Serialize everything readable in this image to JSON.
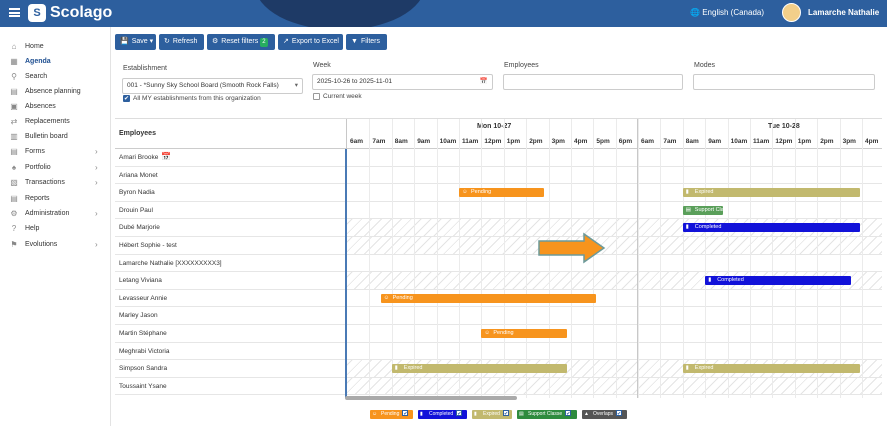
{
  "header": {
    "logo_glyph": "S",
    "app_name": "Scolago",
    "language": "English (Canada)",
    "user": "Lamarche Nathalie"
  },
  "sidebar": {
    "items": [
      {
        "label": "Home",
        "icon": "home-icon"
      },
      {
        "label": "Agenda",
        "icon": "calendar-icon",
        "active": true
      },
      {
        "label": "Search",
        "icon": "search-icon"
      },
      {
        "label": "Absence planning",
        "icon": "absence-planning-icon"
      },
      {
        "label": "Absences",
        "icon": "absences-icon"
      },
      {
        "label": "Replacements",
        "icon": "replacements-icon"
      },
      {
        "label": "Bulletin board",
        "icon": "bulletin-icon"
      },
      {
        "label": "Forms",
        "icon": "forms-icon",
        "chevron": true
      },
      {
        "label": "Portfolio",
        "icon": "trophy-icon",
        "chevron": true
      },
      {
        "label": "Transactions",
        "icon": "transactions-icon",
        "chevron": true
      },
      {
        "label": "Reports",
        "icon": "reports-icon"
      },
      {
        "label": "Administration",
        "icon": "gear-icon",
        "chevron": true
      },
      {
        "label": "Help",
        "icon": "help-icon"
      },
      {
        "label": "Evolutions",
        "icon": "flag-icon",
        "chevron": true
      }
    ]
  },
  "toolbar": {
    "save": "Save",
    "refresh": "Refresh",
    "reset_filters": "Reset filters",
    "reset_count": "2",
    "export": "Export to Excel",
    "filters": "Filters"
  },
  "filters": {
    "establishment_label": "Establishment",
    "establishment_value": "001 - *Sunny Sky School Board (Smooth Rock Falls)",
    "all_my_establishments": "All MY establishments from this organization",
    "week_label": "Week",
    "week_value": "2025-10-26 to 2025-11-01",
    "current_week": "Current week",
    "employees_label": "Employees",
    "modes_label": "Modes"
  },
  "grid": {
    "employees_header": "Employees",
    "days": [
      "Mon 10-27",
      "Tue 10-28"
    ],
    "hours_day1": [
      "6am",
      "7am",
      "8am",
      "9am",
      "10am",
      "11am",
      "12pm",
      "1pm",
      "2pm",
      "3pm",
      "4pm",
      "5pm",
      "6pm"
    ],
    "hours_day2": [
      "6am",
      "7am",
      "8am",
      "9am",
      "10am",
      "11am",
      "12pm",
      "1pm",
      "2pm",
      "3pm",
      "4pm"
    ],
    "employees": [
      {
        "name": "Amari Brooke",
        "hatched": false
      },
      {
        "name": "Ariana Monet",
        "hatched": false
      },
      {
        "name": "Byron Nadia",
        "hatched": false
      },
      {
        "name": "Drouin Paul",
        "hatched": false
      },
      {
        "name": "Dubé Marjorie",
        "hatched": true
      },
      {
        "name": "Hébert Sophie - test",
        "hatched": true
      },
      {
        "name": "Lamarche Nathalie [XXXXXXXXX3]",
        "hatched": false
      },
      {
        "name": "Letang Viviana",
        "hatched": true
      },
      {
        "name": "Levasseur Annie",
        "hatched": false
      },
      {
        "name": "Marley Jason",
        "hatched": false
      },
      {
        "name": "Martin Stéphane",
        "hatched": false
      },
      {
        "name": "Meghrabi Victoria",
        "hatched": false
      },
      {
        "name": "Simpson Sandra",
        "hatched": true
      },
      {
        "name": "Toussaint Ysane",
        "hatched": true
      }
    ],
    "events": [
      {
        "row": 2,
        "start": 11.0,
        "end": 14.8,
        "day": 0,
        "label": "Pending",
        "color": "#f7941d",
        "icon": "person-icon"
      },
      {
        "row": 2,
        "start": 8.0,
        "end": 15.9,
        "day": 1,
        "label": "Expired",
        "color": "#c2b96e",
        "icon": "chat-icon"
      },
      {
        "row": 3,
        "start": 8.0,
        "end": 9.8,
        "day": 1,
        "label": "Support Classe",
        "color": "#5a9f5a",
        "icon": "class-icon"
      },
      {
        "row": 4,
        "start": 8.0,
        "end": 15.9,
        "day": 1,
        "label": "Completed",
        "color": "#1212d9",
        "icon": "chat-icon"
      },
      {
        "row": 7,
        "start": 9.0,
        "end": 15.5,
        "day": 1,
        "label": "Completed",
        "color": "#1212d9",
        "icon": "chat-icon"
      },
      {
        "row": 8,
        "start": 7.5,
        "end": 17.1,
        "day": 0,
        "label": "Pending",
        "color": "#f7941d",
        "icon": "person-icon"
      },
      {
        "row": 10,
        "start": 12.0,
        "end": 15.8,
        "day": 0,
        "label": "Pending",
        "color": "#f7941d",
        "icon": "person-icon"
      },
      {
        "row": 12,
        "start": 8.0,
        "end": 15.8,
        "day": 0,
        "label": "Expired",
        "color": "#c2b96e",
        "icon": "chat-icon"
      },
      {
        "row": 12,
        "start": 8.0,
        "end": 15.9,
        "day": 1,
        "label": "Expired",
        "color": "#c2b96e",
        "icon": "chat-icon"
      }
    ]
  },
  "legend": [
    {
      "label": "Pending",
      "color": "#f7941d"
    },
    {
      "label": "Completed",
      "color": "#1212d9"
    },
    {
      "label": "Expired",
      "color": "#c2b96e"
    },
    {
      "label": "Support Classe",
      "color": "#2e8b3e"
    },
    {
      "label": "Overlaps",
      "color": "#555555"
    }
  ],
  "colors": {
    "primary": "#2d5f9e",
    "header_dark": "#1e3a66",
    "arrow": "#f7941d"
  }
}
